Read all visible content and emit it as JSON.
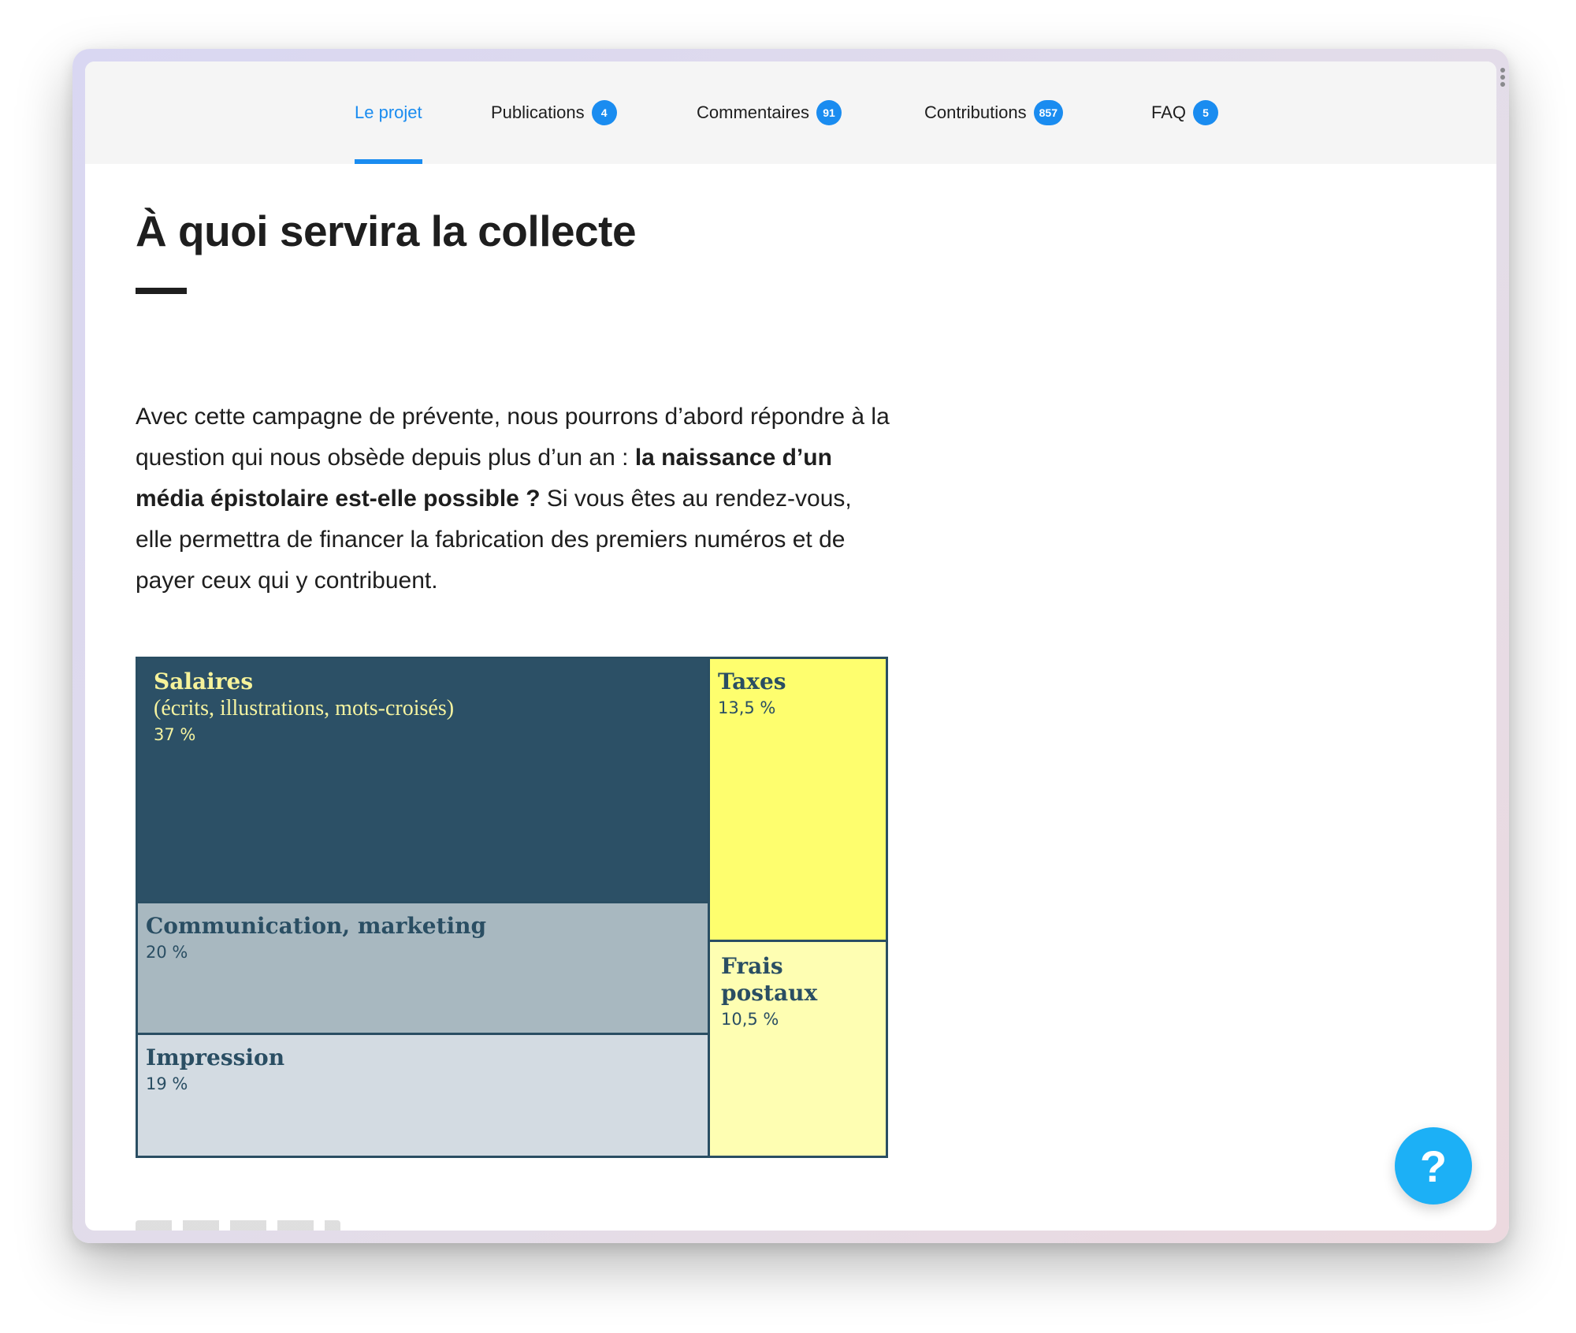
{
  "nav": {
    "tabs": [
      {
        "label": "Le projet",
        "badge": null,
        "active": true
      },
      {
        "label": "Publications",
        "badge": "4",
        "active": false
      },
      {
        "label": "Commentaires",
        "badge": "91",
        "active": false
      },
      {
        "label": "Contributions",
        "badge": "857",
        "active": false
      },
      {
        "label": "FAQ",
        "badge": "5",
        "active": false
      }
    ]
  },
  "main": {
    "title": "À quoi servira la collecte",
    "intro_part1": "Avec cette campagne de prévente, nous pourrons d’abord répondre à la question qui nous obsède depuis plus d’un an : ",
    "intro_bold": "la naissance d’un média épistolaire est-elle possible ?",
    "intro_part2": " Si vous êtes au rendez-vous, elle permettra de financer la fabrication des premiers numéros et de payer ceux qui y contribuent."
  },
  "treemap": {
    "salaires": {
      "name": "Salaires",
      "sub": "(écrits, illustrations, mots-croisés)",
      "pct": "37 %"
    },
    "communication": {
      "name": "Communication, marketing",
      "pct": "20 %"
    },
    "impression": {
      "name": "Impression",
      "pct": "19 %"
    },
    "taxes": {
      "name": "Taxes",
      "pct": "13,5 %"
    },
    "frais": {
      "name_line1": "Frais",
      "name_line2": "postaux",
      "pct": "10,5 %"
    }
  },
  "chart_data": {
    "type": "treemap",
    "categories": [
      "Salaires (écrits, illustrations, mots-croisés)",
      "Communication, marketing",
      "Impression",
      "Taxes",
      "Frais postaux"
    ],
    "values": [
      37,
      20,
      19,
      13.5,
      10.5
    ]
  },
  "colors": {
    "accent": "#1a8cf0",
    "salaires": "#2c5066",
    "communication": "#a8b8c0",
    "impression": "#d3dbe2",
    "taxes": "#fefe6e",
    "frais": "#fefeb2",
    "help": "#1cb0f6"
  },
  "help": {
    "label": "?"
  }
}
